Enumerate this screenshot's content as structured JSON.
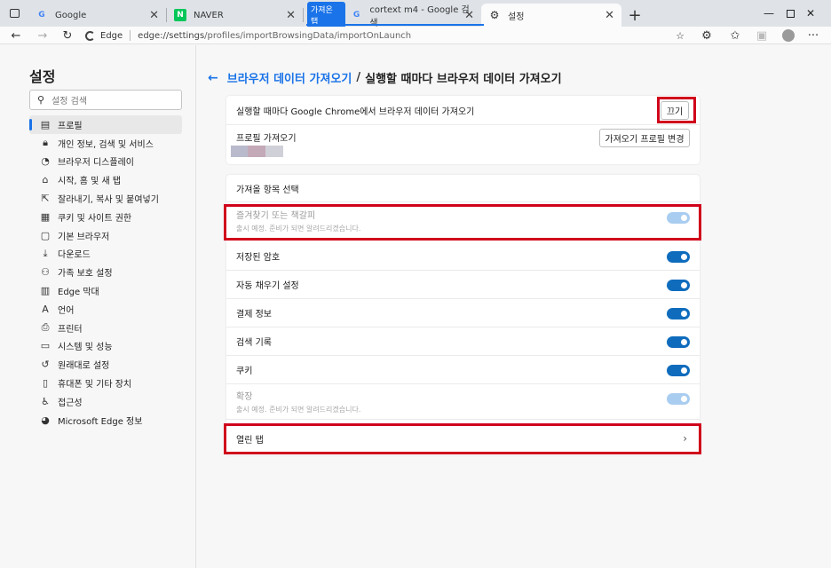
{
  "tabs": [
    {
      "title": "Google",
      "favicon": "google-g-icon",
      "active": false
    },
    {
      "title": "NAVER",
      "favicon": "naver-n-icon",
      "active": false
    },
    {
      "title": "cortext m4 - Google 검색",
      "favicon": "google-g-icon",
      "active": false,
      "group": "가져온 탭"
    },
    {
      "title": "설정",
      "favicon": "gear-icon",
      "active": true
    }
  ],
  "tab_group_label": "가져온 탭",
  "address": {
    "prefix": "Edge",
    "url_host": "edge://settings",
    "url_path": "/profiles/importBrowsingData/importOnLaunch"
  },
  "sidebar": {
    "title": "설정",
    "search_placeholder": "설정 검색",
    "items": [
      {
        "label": "프로필",
        "icon": "profile-icon",
        "active": true
      },
      {
        "label": "개인 정보, 검색 및 서비스",
        "icon": "lock-icon"
      },
      {
        "label": "브라우저 디스플레이",
        "icon": "palette-icon"
      },
      {
        "label": "시작, 홈 및 새 탭",
        "icon": "home-icon"
      },
      {
        "label": "잘라내기, 복사 및 붙여넣기",
        "icon": "share-icon"
      },
      {
        "label": "쿠키 및 사이트 권한",
        "icon": "cookie-icon"
      },
      {
        "label": "기본 브라우저",
        "icon": "browser-icon"
      },
      {
        "label": "다운로드",
        "icon": "download-icon"
      },
      {
        "label": "가족 보호 설정",
        "icon": "family-icon"
      },
      {
        "label": "Edge 막대",
        "icon": "edge-bar-icon"
      },
      {
        "label": "언어",
        "icon": "language-icon"
      },
      {
        "label": "프린터",
        "icon": "printer-icon"
      },
      {
        "label": "시스템 및 성능",
        "icon": "laptop-icon"
      },
      {
        "label": "원래대로 설정",
        "icon": "reset-icon"
      },
      {
        "label": "휴대폰 및 기타 장치",
        "icon": "phone-icon"
      },
      {
        "label": "접근성",
        "icon": "accessibility-icon"
      },
      {
        "label": "Microsoft Edge 정보",
        "icon": "edge-logo-icon"
      }
    ]
  },
  "breadcrumb": {
    "parent": "브라우저 데이터 가져오기",
    "separator": "/",
    "current": "실행할 때마다 브라우저 데이터 가져오기"
  },
  "card1": {
    "import_on_launch_label": "실행할 때마다 Google Chrome에서 브라우저 데이터 가져오기",
    "turn_off_button": "끄기",
    "profile_import_label": "프로필 가져오기",
    "change_profile_button": "가져오기 프로필 변경"
  },
  "card2": {
    "header": "가져올 항목 선택",
    "items": [
      {
        "label": "즐겨찾기 또는 책갈피",
        "sub": "출시 예정. 준비가 되면 알려드리겠습니다.",
        "enabled": false,
        "on": true
      },
      {
        "label": "저장된 암호",
        "enabled": true,
        "on": true
      },
      {
        "label": "자동 채우기 설정",
        "enabled": true,
        "on": true
      },
      {
        "label": "결제 정보",
        "enabled": true,
        "on": true
      },
      {
        "label": "검색 기록",
        "enabled": true,
        "on": true
      },
      {
        "label": "쿠키",
        "enabled": true,
        "on": true
      },
      {
        "label": "확장",
        "sub": "출시 예정. 준비가 되면 알려드리겠습니다.",
        "enabled": false,
        "on": true
      }
    ],
    "open_tabs_label": "열린 탭"
  },
  "colors": {
    "accent": "#1a73e8",
    "toggle_on": "#0f6cbd",
    "toggle_disabled": "#a9cdf0",
    "highlight_box": "#d0021b"
  }
}
